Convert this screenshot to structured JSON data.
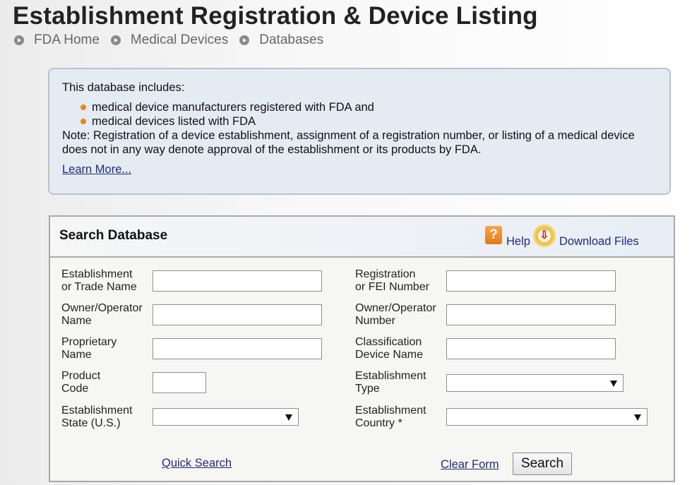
{
  "page": {
    "title": "Establishment Registration & Device Listing"
  },
  "breadcrumb": [
    "FDA Home",
    "Medical Devices",
    "Databases"
  ],
  "info": {
    "intro": "This database includes:",
    "bullets": [
      "medical device manufacturers registered with FDA and",
      "medical devices listed with FDA"
    ],
    "note": "Note: Registration of a device establishment, assignment of a registration number, or listing of a medical device does not in any way denote approval of the establishment or its products by FDA.",
    "learn_more": "Learn More..."
  },
  "search": {
    "title": "Search Database",
    "help_label": "Help",
    "download_label": "Download Files",
    "fields": {
      "establishment_name": "Establishment\nor Trade Name",
      "owner_operator_name": "Owner/Operator\nName",
      "proprietary_name": "Proprietary\nName",
      "product_code": "Product\nCode",
      "establishment_state": "Establishment\nState (U.S.)",
      "registration_number": "Registration\nor FEI Number",
      "owner_operator_number": "Owner/Operator\nNumber",
      "classification_device_name": "Classification\nDevice Name",
      "establishment_type": "Establishment\nType",
      "establishment_country": "Establishment\nCountry *"
    },
    "values": {
      "establishment_name": "",
      "owner_operator_name": "",
      "proprietary_name": "",
      "product_code": "",
      "registration_number": "",
      "owner_operator_number": "",
      "classification_device_name": ""
    },
    "quick_search": "Quick Search",
    "clear_form": "Clear Form",
    "search_button": "Search"
  },
  "colors": {
    "bullet": "#e08a1e",
    "link": "#1f2b78",
    "info_bg": "#e4ebf3"
  },
  "icons": {
    "help": "question-icon",
    "download": "download-icon",
    "breadcrumb": "arrow-circle-icon"
  }
}
